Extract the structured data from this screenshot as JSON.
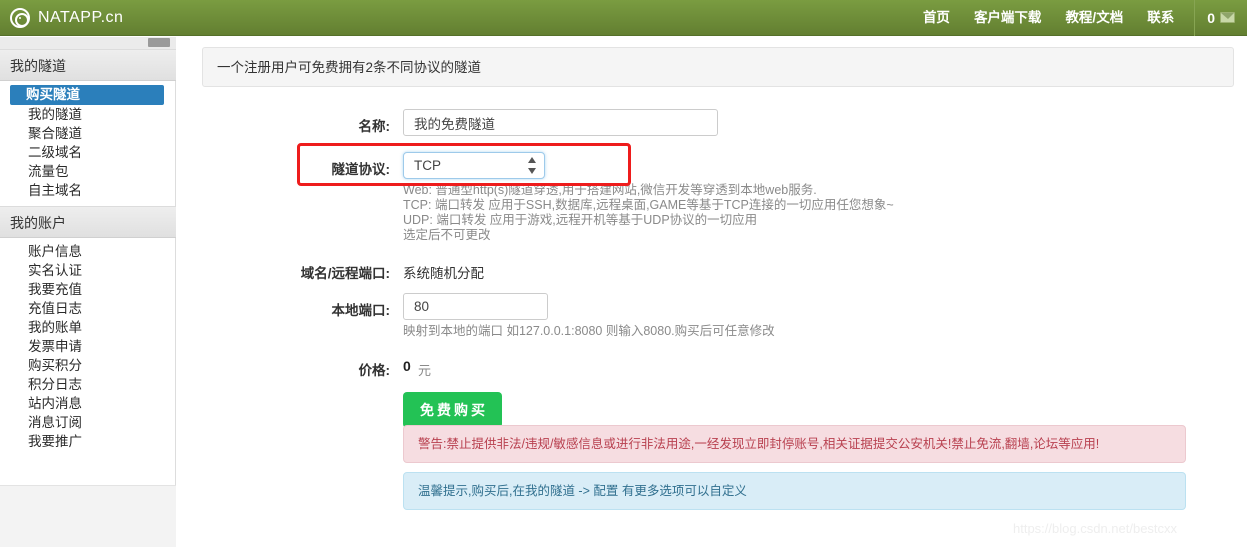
{
  "navbar": {
    "brand": "NATAPP.cn",
    "brand_icon": "spiral-logo-icon",
    "links": [
      "首页",
      "客户端下载",
      "教程/文档",
      "联系"
    ],
    "message_count": "0",
    "message_icon": "envelope-icon",
    "bg_color": "#6b8e37"
  },
  "sidebar": {
    "scrollbar": "vertical-scroll-thumb",
    "sections": [
      {
        "title": "我的隧道",
        "items": [
          {
            "label": "购买隧道",
            "active": true
          },
          {
            "label": "我的隧道",
            "active": false
          },
          {
            "label": "聚合隧道",
            "active": false
          },
          {
            "label": "二级域名",
            "active": false
          },
          {
            "label": "流量包",
            "active": false
          },
          {
            "label": "自主域名",
            "active": false
          }
        ]
      },
      {
        "title": "我的账户",
        "items": [
          {
            "label": "账户信息",
            "active": false
          },
          {
            "label": "实名认证",
            "active": false
          },
          {
            "label": "我要充值",
            "active": false
          },
          {
            "label": "充值日志",
            "active": false
          },
          {
            "label": "我的账单",
            "active": false
          },
          {
            "label": "发票申请",
            "active": false
          },
          {
            "label": "购买积分",
            "active": false
          },
          {
            "label": "积分日志",
            "active": false
          },
          {
            "label": "站内消息",
            "active": false
          },
          {
            "label": "消息订阅",
            "active": false
          },
          {
            "label": "我要推广",
            "active": false
          }
        ]
      }
    ],
    "active_color": "#2b7fbb"
  },
  "main": {
    "panel_heading": "一个注册用户可免费拥有2条不同协议的隧道",
    "form": {
      "name": {
        "label": "名称:",
        "value": "我的免费隧道",
        "placeholder": ""
      },
      "protocol": {
        "label": "隧道协议:",
        "value": "TCP",
        "options": [
          "Web",
          "TCP",
          "UDP"
        ],
        "help_lines": [
          "Web: 普通型http(s)隧道穿透,用于搭建网站,微信开发等穿透到本地web服务.",
          "TCP: 端口转发 应用于SSH,数据库,远程桌面,GAME等基于TCP连接的一切应用任您想象~",
          "UDP: 端口转发 应用于游戏,远程开机等基于UDP协议的一切应用",
          "选定后不可更改"
        ],
        "highlighted": true,
        "highlight_color": "#ee1c1c"
      },
      "remote": {
        "label": "域名/远程端口:",
        "value": "系统随机分配"
      },
      "local_port": {
        "label": "本地端口:",
        "value": "80",
        "placeholder": "",
        "help": "映射到本地的端口 如127.0.0.1:8080 则输入8080.购买后可任意修改"
      },
      "price": {
        "label": "价格:",
        "amount": "0",
        "unit": "元"
      },
      "buy_button": "免费购买"
    },
    "alerts": [
      {
        "type": "danger",
        "text": "警告:禁止提供非法/违规/敏感信息或进行非法用途,一经发现立即封停账号,相关证据提交公安机关!禁止免流,翻墙,论坛等应用!",
        "color": "#b8404f"
      },
      {
        "type": "info",
        "text": "温馨提示,购买后,在我的隧道 -> 配置 有更多选项可以自定义",
        "color": "#31708f"
      }
    ],
    "watermark": "https://blog.csdn.net/bestcxx"
  }
}
